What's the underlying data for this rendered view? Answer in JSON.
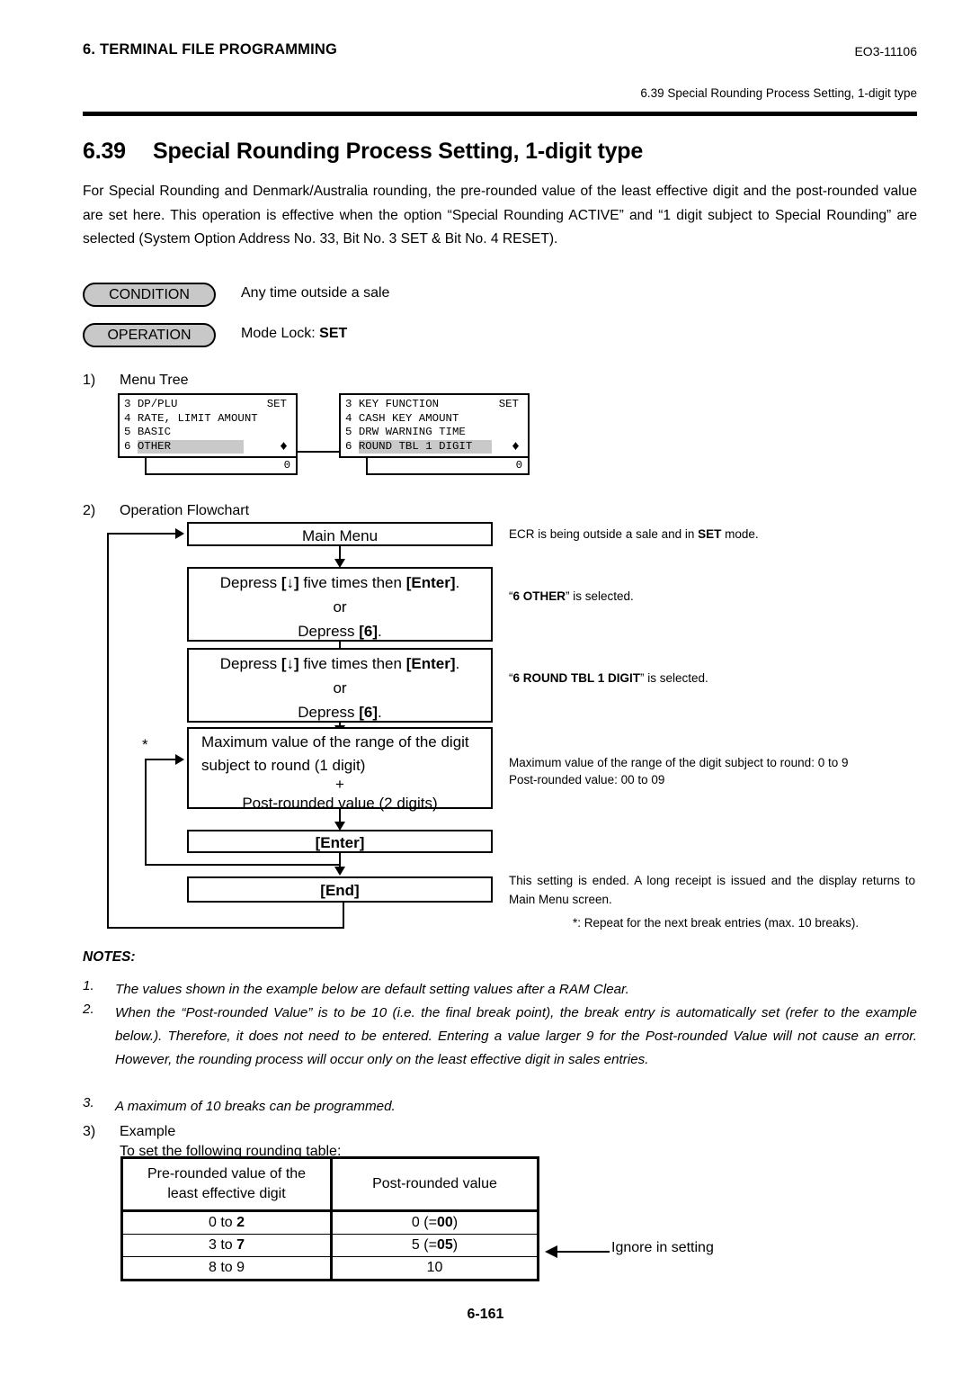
{
  "header": {
    "chapter": "6. TERMINAL FILE PROGRAMMING",
    "doc_code": "EO3-11106",
    "running_head": "6.39 Special Rounding Process Setting, 1-digit type"
  },
  "section": {
    "number": "6.39",
    "title": "Special Rounding Process Setting, 1-digit type",
    "intro": "For Special Rounding and Denmark/Australia rounding, the pre-rounded value of the least effective digit and the post-rounded value are set here.  This operation is effective when the option “Special Rounding ACTIVE” and “1 digit subject to Special Rounding” are selected (System Option Address No. 33, Bit No. 3 SET & Bit No. 4 RESET)."
  },
  "condition": {
    "badge": "CONDITION",
    "text": "Any time outside a sale"
  },
  "operation": {
    "badge": "OPERATION",
    "label": "Mode Lock: ",
    "value": "SET"
  },
  "steps": {
    "one_no": "1)",
    "one_label": "Menu Tree",
    "two_no": "2)",
    "two_label": "Operation Flowchart",
    "three_no": "3)",
    "three_label": "Example",
    "three_sub": "To set the following rounding table:"
  },
  "menu_tree": {
    "left": {
      "rows": [
        {
          "index": "3",
          "text": "DP/PLU",
          "right": "SET",
          "highlight": false
        },
        {
          "index": "4",
          "text": "RATE, LIMIT AMOUNT",
          "right": "",
          "highlight": false
        },
        {
          "index": "5",
          "text": "BASIC",
          "right": "",
          "highlight": false
        },
        {
          "index": "6",
          "text": "OTHER",
          "right": "",
          "highlight": true
        }
      ],
      "marker": "♦",
      "sub_value": "0"
    },
    "right": {
      "rows": [
        {
          "index": "3",
          "text": "KEY FUNCTION",
          "right": "SET",
          "highlight": false
        },
        {
          "index": "4",
          "text": "CASH KEY AMOUNT",
          "right": "",
          "highlight": false
        },
        {
          "index": "5",
          "text": "DRW WARNING TIME",
          "right": "",
          "highlight": false
        },
        {
          "index": "6",
          "text": "ROUND TBL 1 DIGIT",
          "right": "",
          "highlight": true
        }
      ],
      "marker": "♦",
      "sub_value": "0"
    }
  },
  "flowchart": {
    "box1": "Main Menu",
    "box2_l1a": "Depress ",
    "box2_l1b": "[↓]",
    "box2_l1c": " five times then ",
    "box2_l1d": "[Enter]",
    "box2_l1e": ".",
    "box2_or": "or",
    "box2_l3a": "Depress ",
    "box2_l3b": "[6]",
    "box2_l3c": ".",
    "box3_l1a": "Depress ",
    "box3_l1b": "[↓]",
    "box3_l1c": " five times then ",
    "box3_l1d": "[Enter]",
    "box3_l1e": ".",
    "box3_or": "or",
    "box3_l3a": "Depress ",
    "box3_l3b": "[6]",
    "box3_l3c": ".",
    "box4_l1": "Maximum value of the range of the digit",
    "box4_l2": "subject to round (1 digit)",
    "box4_plus": "+",
    "box4_l4": "Post-rounded value (2 digits)",
    "box5": "[Enter]",
    "box6": "[End]",
    "star": "*",
    "note1a": "ECR is being outside a sale and in ",
    "note1b": "SET",
    "note1c": " mode.",
    "note2a": "“",
    "note2b": "6 OTHER",
    "note2c": "” is selected.",
    "note3a": "“",
    "note3b": "6 ROUND TBL 1 DIGIT",
    "note3c": "” is selected.",
    "note4_l1": "Maximum value of the range of the digit subject to round: 0 to 9",
    "note4_l2": "Post-rounded value: 00 to 09",
    "note5": "This setting is ended.   A long receipt is issued and the display returns to Main Menu screen.",
    "note6": "*: Repeat for the next break entries (max. 10 breaks)."
  },
  "notes": {
    "heading": "NOTES:",
    "items": [
      {
        "n": "1.",
        "text": "The values shown in the example below are default setting values after a RAM Clear."
      },
      {
        "n": "2.",
        "text": "When the “Post-rounded Value” is to be 10 (i.e. the final break point), the break entry is automatically set (refer to the example below.).  Therefore, it does not need to be entered.  Entering a value larger 9 for the Post-rounded Value will not cause an error.  However, the rounding process will occur only on the least effective digit in sales entries."
      },
      {
        "n": "3.",
        "text": "A maximum of 10 breaks can be programmed."
      }
    ]
  },
  "example_table": {
    "header": [
      "Pre-rounded value of the least effective digit",
      "Post-rounded value"
    ],
    "header_l1": "Pre-rounded value of the",
    "header_l2": "least effective digit",
    "rows": [
      {
        "pre_plain": "0 to ",
        "pre_bold": "2",
        "post_plain": "0 (=",
        "post_bold": "00",
        "post_tail": ")"
      },
      {
        "pre_plain": "3 to ",
        "pre_bold": "7",
        "post_plain": "5 (=",
        "post_bold": "05",
        "post_tail": ")"
      },
      {
        "pre_plain": "8 to 9",
        "pre_bold": "",
        "post_plain": "10",
        "post_bold": "",
        "post_tail": ""
      }
    ],
    "annotation": "Ignore in setting"
  },
  "footer": {
    "page": "6-161"
  },
  "colors": {
    "ink": "#000000",
    "lcd_highlight": "#c9c9c9",
    "pill_fill": "#c8c8c8"
  }
}
